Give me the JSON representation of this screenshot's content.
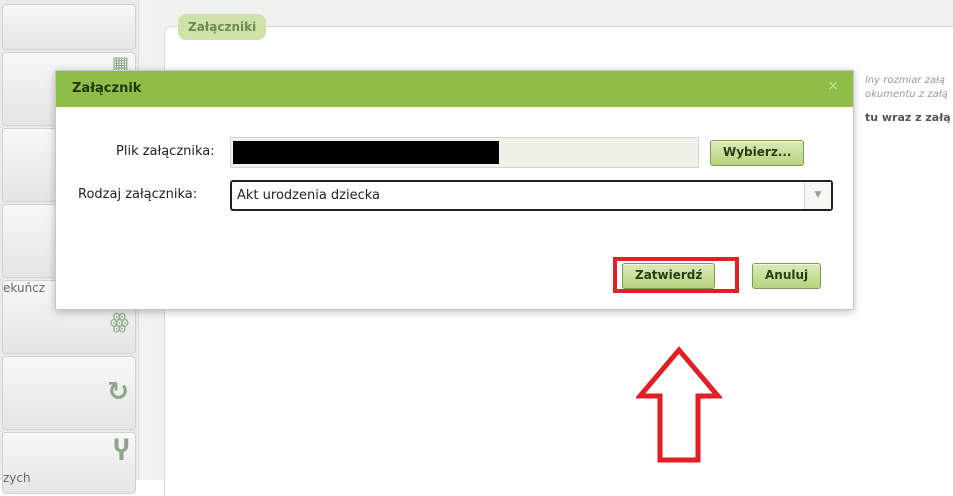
{
  "background": {
    "left_nav": {
      "items": [
        {
          "label": "",
          "icon": "partial-app-icon"
        },
        {
          "label": "",
          "icon": ""
        },
        {
          "label": "",
          "icon": ""
        },
        {
          "label": "ekuńcz",
          "icon": "family-icon"
        },
        {
          "label": "",
          "icon": "refresh-icon"
        },
        {
          "label": "zych",
          "icon": "merge-icon"
        }
      ]
    },
    "attachments_panel": {
      "legend": "Załączniki",
      "info_lines": [
        "lny rozmiar załą",
        "okumentu z załą",
        "tu wraz z załą"
      ]
    }
  },
  "dialog": {
    "title": "Załącznik",
    "close_glyph": "×",
    "file_label": "Plik załącznika:",
    "choose_button": "Wybierz...",
    "type_label": "Rodzaj załącznika:",
    "type_value": "Akt urodzenia dziecka",
    "dropdown_glyph": "▼",
    "confirm_button": "Zatwierdź",
    "cancel_button": "Anuluj"
  },
  "colors": {
    "dialog_header": "#8fbe48",
    "button_green": "#b8d37f",
    "highlight_red": "#e31e25"
  }
}
